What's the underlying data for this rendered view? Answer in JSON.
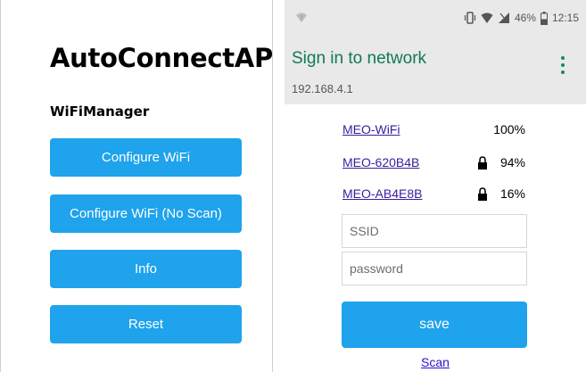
{
  "left": {
    "title": "AutoConnectAP",
    "subtitle": "WiFiManager",
    "buttons": [
      "Configure WiFi",
      "Configure WiFi (No Scan)",
      "Info",
      "Reset"
    ],
    "button_color": "#1fa3ec"
  },
  "right": {
    "status_bar": {
      "icons": [
        "wifi-question-icon",
        "vibrate-icon",
        "wifi-icon",
        "signal-icon",
        "battery-icon"
      ],
      "battery": "46%",
      "time": "12:15"
    },
    "appbar": {
      "title": "Sign in to network",
      "subtitle": "192.168.4.1",
      "title_color": "#107a55"
    },
    "networks": [
      {
        "name": "MEO-WiFi",
        "locked": false,
        "signal": "100%"
      },
      {
        "name": "MEO-620B4B",
        "locked": true,
        "signal": "94%"
      },
      {
        "name": "MEO-AB4E8B",
        "locked": true,
        "signal": "16%"
      }
    ],
    "ssid_placeholder": "SSID",
    "password_placeholder": "password",
    "save_label": "save",
    "scan_label": "Scan"
  }
}
